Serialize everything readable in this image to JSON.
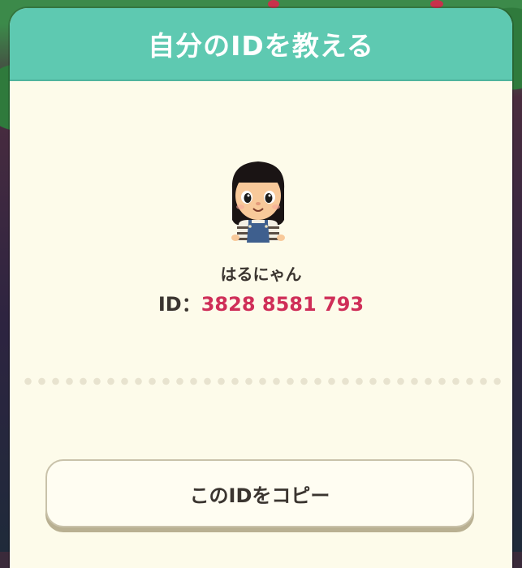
{
  "dialog": {
    "title": "自分のIDを教える"
  },
  "profile": {
    "name": "はるにゃん",
    "id_label": "ID：",
    "id_value": "3828 8581 793",
    "id_color": "#cf2e58"
  },
  "actions": {
    "copy_label": "このIDをコピー"
  },
  "colors": {
    "header": "#5ec9b1",
    "panel": "#fdfbea"
  }
}
